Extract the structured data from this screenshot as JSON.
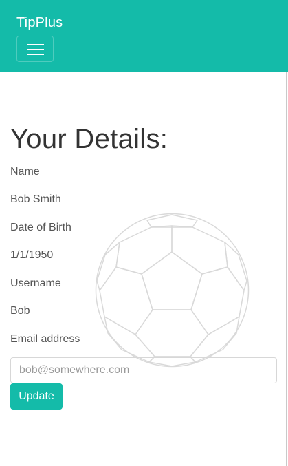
{
  "navbar": {
    "brand": "TipPlus",
    "toggler_icon": "hamburger-menu-icon",
    "background_color": "#14bba9"
  },
  "background": {
    "icon": "soccer-ball-icon"
  },
  "page": {
    "title": "Your Details:"
  },
  "details": {
    "name_label": "Name",
    "name_value": "Bob Smith",
    "dob_label": "Date of Birth",
    "dob_value": "1/1/1950",
    "username_label": "Username",
    "username_value": "Bob",
    "email_label": "Email address"
  },
  "form": {
    "email_placeholder": "bob@somewhere.com",
    "update_label": "Update",
    "accent_color": "#14bba9"
  }
}
